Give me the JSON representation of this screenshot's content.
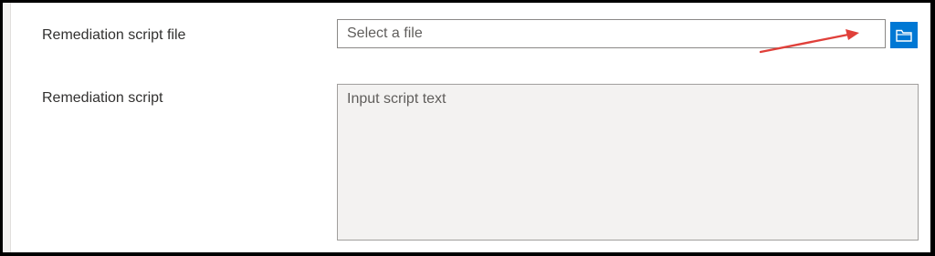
{
  "fields": {
    "file_label": "Remediation script file",
    "file_placeholder": "Select a file",
    "script_label": "Remediation script",
    "script_placeholder": "Input script text"
  },
  "icons": {
    "browse": "folder-icon",
    "annotation": "red-arrow-icon"
  },
  "colors": {
    "accent": "#0078d4",
    "annotation": "#e0403a",
    "disabled_bg": "#f3f2f1"
  }
}
